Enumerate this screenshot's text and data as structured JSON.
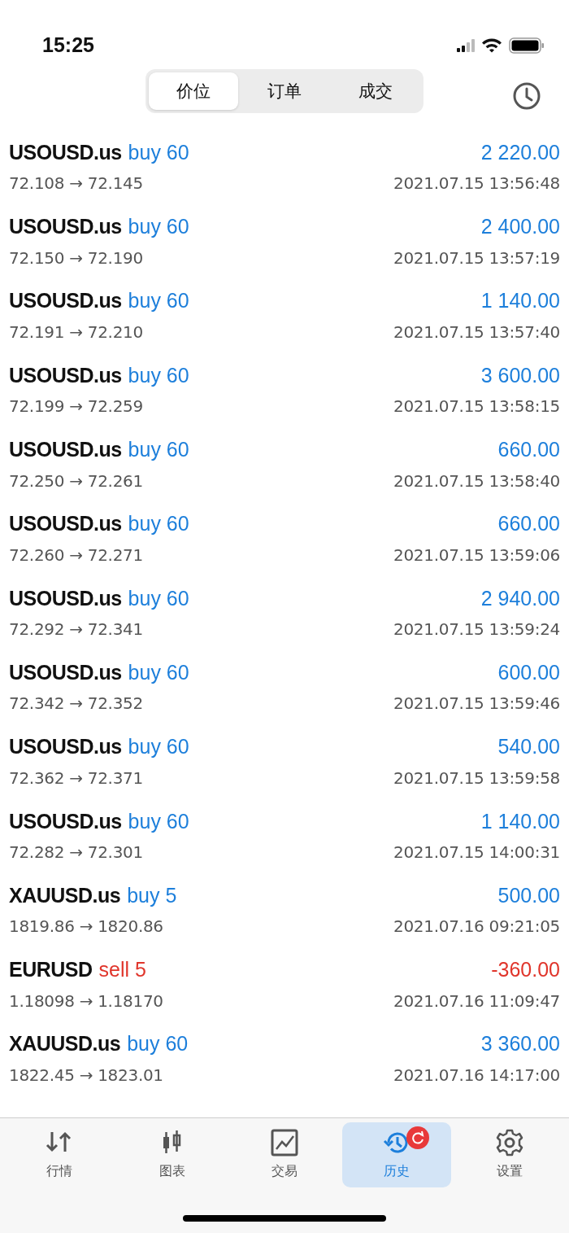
{
  "status_bar": {
    "time": "15:25"
  },
  "segments": [
    {
      "label": "价位",
      "selected": true
    },
    {
      "label": "订单",
      "selected": false
    },
    {
      "label": "成交",
      "selected": false
    }
  ],
  "deals": [
    {
      "symbol": "USOUSD.us",
      "side": "buy 60",
      "kind": "buy",
      "profit": "2 220.00",
      "negative": false,
      "prices": "72.108 → 72.145",
      "time": "2021.07.15 13:56:48"
    },
    {
      "symbol": "USOUSD.us",
      "side": "buy 60",
      "kind": "buy",
      "profit": "2 400.00",
      "negative": false,
      "prices": "72.150 → 72.190",
      "time": "2021.07.15 13:57:19"
    },
    {
      "symbol": "USOUSD.us",
      "side": "buy 60",
      "kind": "buy",
      "profit": "1 140.00",
      "negative": false,
      "prices": "72.191 → 72.210",
      "time": "2021.07.15 13:57:40"
    },
    {
      "symbol": "USOUSD.us",
      "side": "buy 60",
      "kind": "buy",
      "profit": "3 600.00",
      "negative": false,
      "prices": "72.199 → 72.259",
      "time": "2021.07.15 13:58:15"
    },
    {
      "symbol": "USOUSD.us",
      "side": "buy 60",
      "kind": "buy",
      "profit": "660.00",
      "negative": false,
      "prices": "72.250 → 72.261",
      "time": "2021.07.15 13:58:40"
    },
    {
      "symbol": "USOUSD.us",
      "side": "buy 60",
      "kind": "buy",
      "profit": "660.00",
      "negative": false,
      "prices": "72.260 → 72.271",
      "time": "2021.07.15 13:59:06"
    },
    {
      "symbol": "USOUSD.us",
      "side": "buy 60",
      "kind": "buy",
      "profit": "2 940.00",
      "negative": false,
      "prices": "72.292 → 72.341",
      "time": "2021.07.15 13:59:24"
    },
    {
      "symbol": "USOUSD.us",
      "side": "buy 60",
      "kind": "buy",
      "profit": "600.00",
      "negative": false,
      "prices": "72.342 → 72.352",
      "time": "2021.07.15 13:59:46"
    },
    {
      "symbol": "USOUSD.us",
      "side": "buy 60",
      "kind": "buy",
      "profit": "540.00",
      "negative": false,
      "prices": "72.362 → 72.371",
      "time": "2021.07.15 13:59:58"
    },
    {
      "symbol": "USOUSD.us",
      "side": "buy 60",
      "kind": "buy",
      "profit": "1 140.00",
      "negative": false,
      "prices": "72.282 → 72.301",
      "time": "2021.07.15 14:00:31"
    },
    {
      "symbol": "XAUUSD.us",
      "side": "buy 5",
      "kind": "buy",
      "profit": "500.00",
      "negative": false,
      "prices": "1819.86 → 1820.86",
      "time": "2021.07.16 09:21:05"
    },
    {
      "symbol": "EURUSD",
      "side": "sell 5",
      "kind": "sell",
      "profit": "-360.00",
      "negative": true,
      "prices": "1.18098 → 1.18170",
      "time": "2021.07.16 11:09:47"
    },
    {
      "symbol": "XAUUSD.us",
      "side": "buy 60",
      "kind": "buy",
      "profit": "3 360.00",
      "negative": false,
      "prices": "1822.45 → 1823.01",
      "time": "2021.07.16 14:17:00"
    }
  ],
  "tab_bar": [
    {
      "label": "行情",
      "kind": "quotes",
      "selected": false,
      "badge": false
    },
    {
      "label": "图表",
      "kind": "chart",
      "selected": false,
      "badge": false
    },
    {
      "label": "交易",
      "kind": "trade",
      "selected": false,
      "badge": false
    },
    {
      "label": "历史",
      "kind": "history",
      "selected": true,
      "badge": true
    },
    {
      "label": "设置",
      "kind": "settings",
      "selected": false,
      "badge": false
    }
  ]
}
